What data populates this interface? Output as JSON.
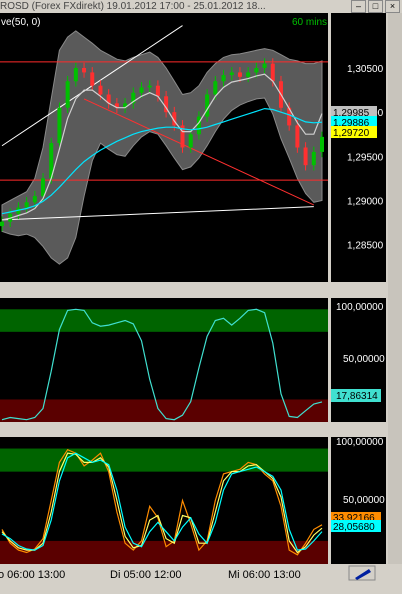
{
  "window": {
    "title": "ROSD (Forex FXdirekt) 19.01.2012 17:00 - 25.01.2012 18...",
    "buttons": [
      "–",
      "□",
      "×"
    ]
  },
  "chart_data": [
    {
      "type": "line",
      "panel": "price",
      "title": "ve(50, 0)",
      "timeframe": "60 mins",
      "ylim": [
        1.281,
        1.311
      ],
      "yticks": [
        "1,30500",
        "1,30000",
        "1,29500",
        "1,29000",
        "1,28500"
      ],
      "ytick_values": [
        1.305,
        1.3,
        1.295,
        1.29,
        1.285
      ],
      "price_labels": [
        {
          "text": "1,29985",
          "value": 1.29985,
          "color": "#c0c0c0"
        },
        {
          "text": "1,29886",
          "value": 1.29886,
          "color": "#00ffff"
        },
        {
          "text": "1,29720",
          "value": 1.2972,
          "color": "#ffff00"
        }
      ],
      "hlines": [
        {
          "value": 1.3057,
          "color": "#ff2a2a"
        },
        {
          "value": 1.2923,
          "color": "#ff2a2a"
        }
      ],
      "series": [
        {
          "values": [
            1.2876,
            1.2885,
            1.2892,
            1.2898,
            1.2905,
            1.2925,
            1.2965,
            1.3005,
            1.3035,
            1.305,
            1.3045,
            1.303,
            1.302,
            1.301,
            1.3005,
            1.301,
            1.3022,
            1.3028,
            1.303,
            1.3018,
            1.3,
            1.2985,
            1.296,
            1.2975,
            1.2995,
            1.302,
            1.3035,
            1.3042,
            1.3045,
            1.304,
            1.3045,
            1.305,
            1.3055,
            1.3035,
            1.3005,
            1.2985,
            1.296,
            1.294,
            1.2955,
            1.2972
          ]
        },
        {
          "color": "#00e5ff",
          "values": [
            1.2885,
            1.2887,
            1.2889,
            1.2891,
            1.2894,
            1.2899,
            1.2906,
            1.2915,
            1.2925,
            1.2935,
            1.2944,
            1.2951,
            1.2957,
            1.2962,
            1.2967,
            1.2971,
            1.2975,
            1.2978,
            1.298,
            1.2982,
            1.2983,
            1.2983,
            1.2981,
            1.298,
            1.2981,
            1.2983,
            1.2986,
            1.2989,
            1.2992,
            1.2995,
            1.2998,
            1.3001,
            1.3004,
            1.3003,
            1.3,
            1.2997,
            1.2993,
            1.2989,
            1.2988,
            1.29886
          ]
        },
        {
          "color": "#d0d0d0",
          "values": [
            1.2878,
            1.288,
            1.2883,
            1.2886,
            1.2891,
            1.2902,
            1.2925,
            1.2958,
            1.2993,
            1.3015,
            1.3025,
            1.3025,
            1.3018,
            1.301,
            1.3005,
            1.3005,
            1.3012,
            1.3018,
            1.3022,
            1.3018,
            1.3005,
            1.299,
            1.2978,
            1.2978,
            1.2988,
            1.3003,
            1.3018,
            1.3028,
            1.3034,
            1.3036,
            1.3038,
            1.3041,
            1.3043,
            1.3035,
            1.302,
            1.3004,
            1.2988,
            1.2975,
            1.2975,
            1.29985
          ]
        },
        {
          "name": "upper_band",
          "values": [
            1.2895,
            1.29,
            1.2905,
            1.291,
            1.2925,
            1.296,
            1.3015,
            1.307,
            1.3085,
            1.3092,
            1.3085,
            1.3078,
            1.307,
            1.3065,
            1.306,
            1.3058,
            1.3062,
            1.3065,
            1.3068,
            1.3062,
            1.305,
            1.3035,
            1.302,
            1.3022,
            1.303,
            1.3045,
            1.3055,
            1.3062,
            1.3065,
            1.3066,
            1.3068,
            1.307,
            1.3072,
            1.307,
            1.3065,
            1.306,
            1.3058,
            1.3055,
            1.3055,
            1.3058
          ]
        },
        {
          "name": "lower_band",
          "values": [
            1.2865,
            1.2862,
            1.286,
            1.2862,
            1.2858,
            1.2848,
            1.2835,
            1.2828,
            1.2835,
            1.2858,
            1.2905,
            1.2945,
            1.2965,
            1.2958,
            1.2952,
            1.295,
            1.2962,
            1.2972,
            1.2978,
            1.2975,
            1.2962,
            1.2948,
            1.2935,
            1.2938,
            1.2948,
            1.2962,
            1.2978,
            1.2992,
            1.3002,
            1.3008,
            1.3012,
            1.3015,
            1.3016,
            1.2998,
            1.297,
            1.2948,
            1.2925,
            1.2908,
            1.2898,
            1.29
          ]
        }
      ],
      "trendlines": [
        {
          "color": "#ffffff",
          "points": [
            [
              0,
              1.2962
            ],
            [
              22,
              1.3098
            ]
          ]
        },
        {
          "color": "#ffffff",
          "points": [
            [
              0,
              1.2878
            ],
            [
              38,
              1.2893
            ]
          ]
        },
        {
          "color": "#ff3030",
          "points": [
            [
              10,
              1.3015
            ],
            [
              38,
              1.2895
            ]
          ]
        }
      ]
    },
    {
      "type": "line",
      "panel": "oscillator1",
      "ylim": [
        0,
        110
      ],
      "yticks": [
        "100,00000",
        "50,00000"
      ],
      "ytick_values": [
        100,
        50
      ],
      "zones": [
        {
          "from": 80,
          "to": 100,
          "color": "#006400"
        },
        {
          "from": 0,
          "to": 20,
          "color": "#5a0000"
        }
      ],
      "value_label": "17,86314",
      "series": [
        {
          "color": "#40e0d0",
          "values": [
            2,
            4,
            3,
            2,
            4,
            12,
            45,
            82,
            99,
            100,
            99,
            88,
            85,
            86,
            88,
            90,
            87,
            72,
            38,
            12,
            3,
            2,
            6,
            18,
            48,
            76,
            90,
            92,
            86,
            92,
            99,
            100,
            97,
            70,
            25,
            5,
            4,
            10,
            16,
            17.86314
          ]
        }
      ]
    },
    {
      "type": "line",
      "panel": "oscillator2",
      "ylim": [
        0,
        110
      ],
      "yticks": [
        "100,00000",
        "50,00000"
      ],
      "ytick_values": [
        100,
        50
      ],
      "zones": [
        {
          "from": 80,
          "to": 100,
          "color": "#006400"
        },
        {
          "from": 0,
          "to": 20,
          "color": "#5a0000"
        }
      ],
      "value_labels": [
        {
          "text": "33,92166",
          "color": "#ff8c00"
        },
        {
          "text": "28,05680",
          "color": "#00ffff"
        }
      ],
      "series": [
        {
          "color": "#ff8c00",
          "values": [
            30,
            18,
            12,
            10,
            13,
            22,
            55,
            88,
            99,
            96,
            85,
            90,
            96,
            80,
            45,
            18,
            12,
            20,
            50,
            40,
            15,
            20,
            55,
            35,
            12,
            20,
            55,
            78,
            80,
            82,
            88,
            86,
            78,
            72,
            50,
            12,
            8,
            18,
            30,
            33.92166
          ]
        },
        {
          "color": "#ffff66",
          "values": [
            28,
            20,
            14,
            12,
            12,
            18,
            45,
            80,
            96,
            95,
            88,
            88,
            92,
            84,
            55,
            24,
            14,
            16,
            38,
            42,
            22,
            18,
            42,
            40,
            18,
            18,
            45,
            72,
            80,
            80,
            85,
            86,
            80,
            74,
            58,
            20,
            10,
            15,
            25,
            31
          ]
        },
        {
          "color": "#00ffff",
          "values": [
            26,
            22,
            16,
            13,
            12,
            16,
            38,
            72,
            92,
            96,
            92,
            88,
            90,
            86,
            64,
            32,
            18,
            15,
            28,
            36,
            28,
            20,
            32,
            40,
            26,
            18,
            36,
            64,
            78,
            80,
            82,
            84,
            80,
            76,
            64,
            30,
            12,
            13,
            20,
            28.0568
          ]
        }
      ]
    }
  ],
  "xaxis": {
    "labels": [
      "o 06:00 13:00",
      "Di 05:00 12:00",
      "Mi 06:00 13:00"
    ]
  },
  "colors": {
    "plot_bg": "#000000",
    "axis_bg": "#000000",
    "frame": "#d4d0c8",
    "bands_fill": "#5a5a5a",
    "candle_up": "#00c000",
    "candle_down": "#ff3030",
    "text": "#ffffff",
    "timeframe_text": "#00c000"
  },
  "icons": {
    "toolbar_corner": "pencil-icon"
  }
}
